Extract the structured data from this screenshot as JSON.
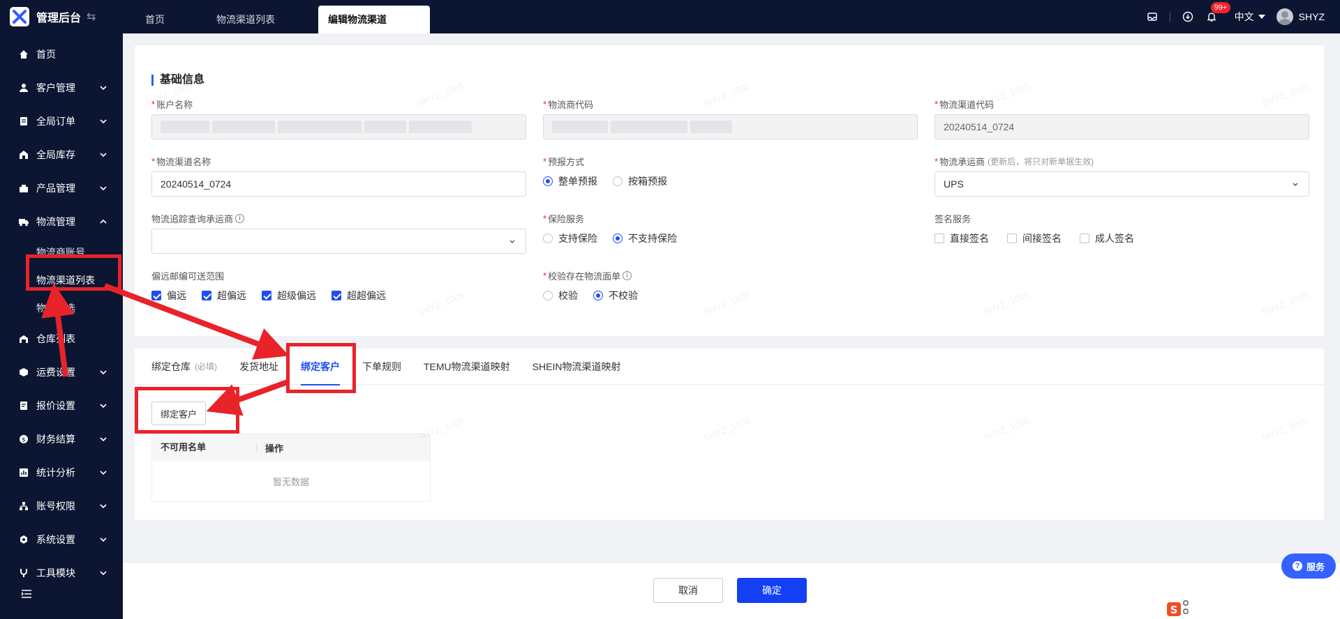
{
  "app": {
    "title": "管理后台",
    "tabs": [
      {
        "label": "首页"
      },
      {
        "label": "物流渠道列表"
      },
      {
        "label": "编辑物流渠道"
      }
    ],
    "notification_badge": "99+",
    "language": "中文",
    "username": "SHYZ"
  },
  "sidebar": {
    "items": [
      {
        "label": "首页",
        "icon": "home-icon"
      },
      {
        "label": "客户管理",
        "icon": "user-icon"
      },
      {
        "label": "全局订单",
        "icon": "order-icon"
      },
      {
        "label": "全局库存",
        "icon": "stock-icon"
      },
      {
        "label": "产品管理",
        "icon": "product-icon"
      },
      {
        "label": "物流管理",
        "icon": "truck-icon"
      },
      {
        "label": "仓库列表",
        "icon": "warehouse-icon"
      },
      {
        "label": "运费设置",
        "icon": "freight-icon"
      },
      {
        "label": "报价设置",
        "icon": "quote-icon"
      },
      {
        "label": "财务结算",
        "icon": "finance-icon"
      },
      {
        "label": "统计分析",
        "icon": "chart-icon"
      },
      {
        "label": "账号权限",
        "icon": "org-icon"
      },
      {
        "label": "系统设置",
        "icon": "settings-icon"
      },
      {
        "label": "工具模块",
        "icon": "tool-icon"
      }
    ],
    "logistics_sub": [
      {
        "label": "物流商账号"
      },
      {
        "label": "物流渠道列表"
      },
      {
        "label": "物流优选"
      }
    ]
  },
  "form": {
    "section_title": "基础信息",
    "account_name_label": "账户名称",
    "provider_code_label": "物流商代码",
    "channel_code_label": "物流渠道代码",
    "channel_code_value": "20240514_0724",
    "channel_name_label": "物流渠道名称",
    "channel_name_value": "20240514_0724",
    "forecast_label": "预报方式",
    "forecast_options": [
      "整单预报",
      "按箱预报"
    ],
    "carrier_label": "物流承运商",
    "carrier_hint": "(更新后，将只对新单据生效)",
    "carrier_value": "UPS",
    "tracking_carrier_label": "物流追踪查询承运商",
    "insurance_label": "保险服务",
    "insurance_options": [
      "支持保险",
      "不支持保险"
    ],
    "signature_label": "签名服务",
    "signature_options": [
      "直接签名",
      "间接签名",
      "成人签名"
    ],
    "remote_label": "偏远邮编可送范围",
    "remote_options": [
      "偏远",
      "超偏远",
      "超级偏远",
      "超超偏远"
    ],
    "verify_label": "校验存在物流面单",
    "verify_options": [
      "校验",
      "不校验"
    ]
  },
  "tabs": {
    "items": [
      "绑定仓库",
      "发货地址",
      "绑定客户",
      "下单规则",
      "TEMU物流渠道映射",
      "SHEIN物流渠道映射"
    ],
    "required_hint": "(必填)",
    "bind_button": "绑定客户",
    "table_headers": [
      "不可用名单",
      "操作"
    ],
    "empty_text": "暂无数据"
  },
  "footer": {
    "cancel": "取消",
    "confirm": "确定"
  },
  "service": "服务",
  "watermark": "SHYZ_1005",
  "colors": {
    "sidebar_bg": "#0c1632",
    "accent": "#1d4ef5",
    "primary_button": "#1340f5",
    "annotation_red": "#e8232a"
  }
}
